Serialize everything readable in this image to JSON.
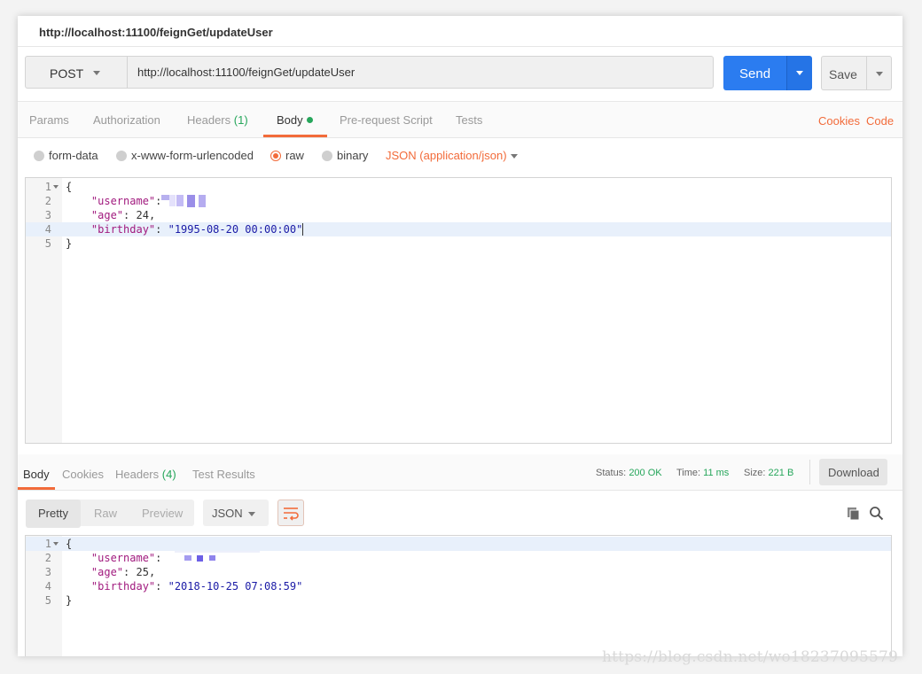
{
  "tab": {
    "title": "http://localhost:11100/feignGet/updateUser"
  },
  "request": {
    "method": "POST",
    "url": "http://localhost:11100/feignGet/updateUser",
    "send_label": "Send",
    "save_label": "Save"
  },
  "request_tabs": {
    "params": "Params",
    "authorization": "Authorization",
    "headers": "Headers",
    "headers_count": "(1)",
    "body": "Body",
    "prerequest": "Pre-request Script",
    "tests": "Tests",
    "cookies": "Cookies",
    "code": "Code"
  },
  "body_options": {
    "form_data": "form-data",
    "urlencoded": "x-www-form-urlencoded",
    "raw": "raw",
    "binary": "binary",
    "content_type": "JSON (application/json)"
  },
  "request_body": {
    "line_numbers": [
      "1",
      "2",
      "3",
      "4",
      "5"
    ],
    "open_brace": "{",
    "close_brace": "}",
    "username_key": "\"username\"",
    "age_key": "\"age\"",
    "age_value": "24",
    "birthday_key": "\"birthday\"",
    "birthday_value": "\"1995-08-20 00:00:00\""
  },
  "response_tabs": {
    "body": "Body",
    "cookies": "Cookies",
    "headers": "Headers",
    "headers_count": "(4)",
    "test_results": "Test Results"
  },
  "response_status": {
    "status_label": "Status:",
    "status_value": "200 OK",
    "time_label": "Time:",
    "time_value": "11 ms",
    "size_label": "Size:",
    "size_value": "221 B",
    "download_label": "Download"
  },
  "response_view": {
    "pretty": "Pretty",
    "raw": "Raw",
    "preview": "Preview",
    "format": "JSON"
  },
  "response_body": {
    "line_numbers": [
      "1",
      "2",
      "3",
      "4",
      "5"
    ],
    "open_brace": "{",
    "close_brace": "}",
    "username_key": "\"username\"",
    "age_key": "\"age\"",
    "age_value": "25",
    "birthday_key": "\"birthday\"",
    "birthday_value": "\"2018-10-25 07:08:59\""
  },
  "watermark": "https://blog.csdn.net/wo18237095579",
  "colors": {
    "accent": "#f26b3a",
    "send": "#2b7cf0",
    "success": "#26a65b"
  }
}
